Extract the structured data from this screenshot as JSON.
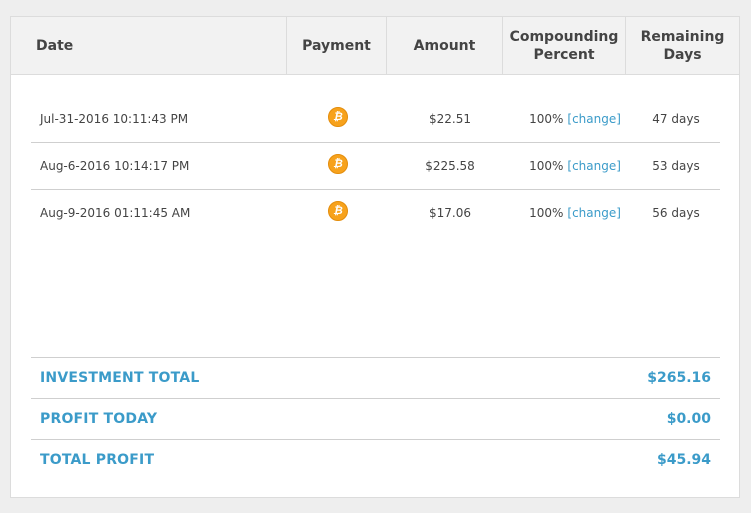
{
  "table": {
    "headers": {
      "date": "Date",
      "payment": "Payment",
      "amount": "Amount",
      "compounding": "Compounding\nPercent",
      "remaining": "Remaining\nDays"
    },
    "rows": [
      {
        "date": "Jul-31-2016 10:11:43 PM",
        "payment_icon": "bitcoin-icon",
        "amount": "$22.51",
        "percent": "100%",
        "change_label": "[change]",
        "days": "47 days"
      },
      {
        "date": "Aug-6-2016 10:14:17 PM",
        "payment_icon": "bitcoin-icon",
        "amount": "$225.58",
        "percent": "100%",
        "change_label": "[change]",
        "days": "53 days"
      },
      {
        "date": "Aug-9-2016 01:11:45 AM",
        "payment_icon": "bitcoin-icon",
        "amount": "$17.06",
        "percent": "100%",
        "change_label": "[change]",
        "days": "56 days"
      }
    ]
  },
  "summary": [
    {
      "label": "INVESTMENT TOTAL",
      "value": "$265.16"
    },
    {
      "label": "PROFIT TODAY",
      "value": "$0.00"
    },
    {
      "label": "TOTAL PROFIT",
      "value": "$45.94"
    }
  ],
  "colors": {
    "accent": "#3b9bc9",
    "bitcoin": "#f7a21c",
    "header_bg": "#f2f2f2"
  },
  "icons": {
    "bitcoin_glyph": "₿"
  }
}
